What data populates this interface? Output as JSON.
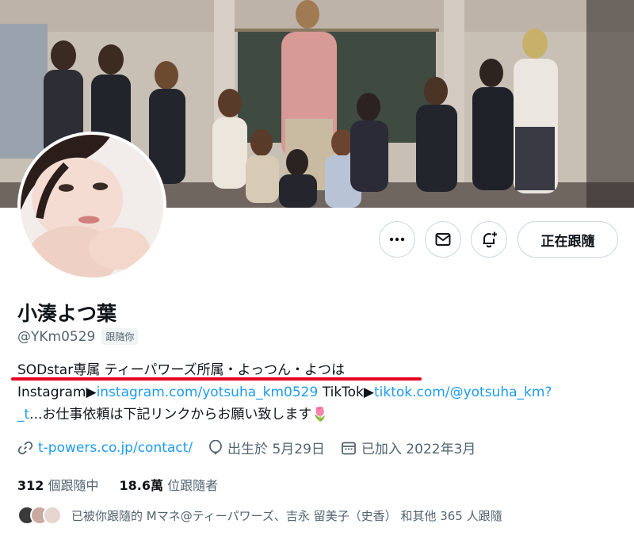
{
  "profile": {
    "display_name": "小湊よつ葉",
    "handle": "@YKm0529",
    "follows_you_badge": "跟隨你",
    "follow_button_label": "正在跟隨"
  },
  "bio": {
    "line1": "SODstar専属 ティーパワーズ所属・よっつん・よつは",
    "line2_prefix": "Instagram▶",
    "line2_instagram": "instagram.com/yotsuha_km0529",
    "line2_middle": " TikTok▶",
    "line2_tiktok": "tiktok.com/@yotsuha_km?",
    "line3_link": "_t",
    "line3_text": "...お仕事依頼は下記リンクからお願い致します🌷"
  },
  "meta": {
    "website": "t-powers.co.jp/contact/",
    "birthday": "出生於 5月29日",
    "joined": "已加入 2022年3月"
  },
  "stats": {
    "following_count": "312",
    "following_label": "個跟隨中",
    "followers_count": "18.6萬",
    "followers_label": "位跟隨者"
  },
  "followed_by_text": "已被你跟隨的 Mマネ@ティーパワーズ、吉永 留美子（史香） 和其他 365 人跟隨",
  "colors": {
    "link": "#1d9bf0",
    "secondary_text": "#536471",
    "annotation_underline": "#e6001f"
  }
}
